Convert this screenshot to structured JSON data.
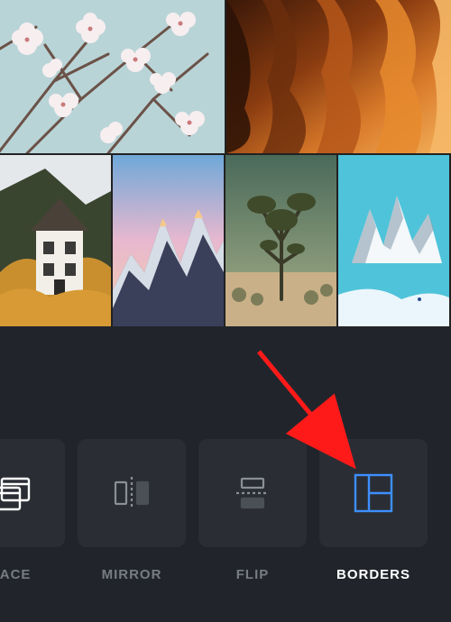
{
  "tools": [
    {
      "id": "replace",
      "label": "LACE"
    },
    {
      "id": "mirror",
      "label": "MIRROR"
    },
    {
      "id": "flip",
      "label": "FLIP"
    },
    {
      "id": "borders",
      "label": "BORDERS"
    }
  ],
  "active_tool": "borders",
  "selected_color": "#3e8fff"
}
